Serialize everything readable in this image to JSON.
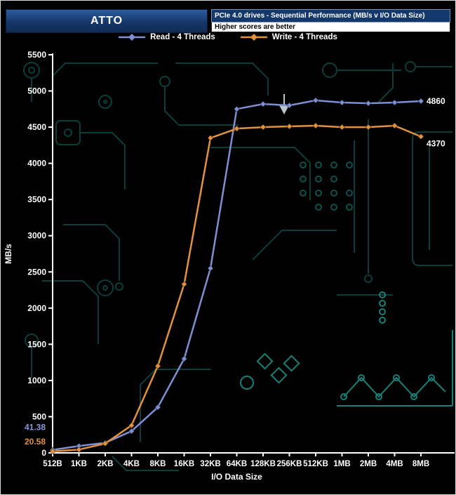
{
  "header": {
    "app_title": "ATTO",
    "chart_title": "PCIe 4.0 drives - Sequential Performance (MB/s v I/O Data Size)",
    "subtitle": "Higher scores are better"
  },
  "legend": [
    {
      "label": "Read - 4 Threads",
      "color": "#7e8fd2"
    },
    {
      "label": "Write - 4 Threads",
      "color": "#e2923e"
    }
  ],
  "chart_data": {
    "type": "line",
    "title": "PCIe 4.0 drives - Sequential Performance (MB/s v I/O Data Size)",
    "subtitle": "Higher scores are better",
    "categories": [
      "512B",
      "1KB",
      "2KB",
      "4KB",
      "8KB",
      "16KB",
      "32KB",
      "64KB",
      "128KB",
      "256KB",
      "512KB",
      "1MB",
      "2MB",
      "4MB",
      "8MB"
    ],
    "series": [
      {
        "name": "Read - 4 Threads",
        "color": "#7e8fd2",
        "values": [
          41.38,
          95,
          140,
          300,
          630,
          1300,
          2550,
          4750,
          4820,
          4800,
          4870,
          4840,
          4830,
          4840,
          4860
        ]
      },
      {
        "name": "Write - 4 Threads",
        "color": "#e2923e",
        "values": [
          20.58,
          45,
          130,
          380,
          1200,
          2330,
          4350,
          4480,
          4500,
          4510,
          4520,
          4500,
          4500,
          4520,
          4370
        ]
      }
    ],
    "annotations": [
      {
        "text": "41.38",
        "series": 0,
        "point": 0,
        "color": "#8a9ae0",
        "dx": -40,
        "dy": -28,
        "anchor": "start"
      },
      {
        "text": "20.58",
        "series": 1,
        "point": 0,
        "color": "#e2923e",
        "dx": -40,
        "dy": -10,
        "anchor": "start"
      },
      {
        "text": "4860",
        "series": 0,
        "point": 14,
        "color": "#ffffff",
        "dx": 8,
        "dy": 4,
        "anchor": "start"
      },
      {
        "text": "4370",
        "series": 1,
        "point": 14,
        "color": "#ffffff",
        "dx": 8,
        "dy": 14,
        "anchor": "start"
      }
    ],
    "xlabel": "I/O Data Size",
    "ylabel": "MB/s",
    "ylim": [
      0,
      5500
    ],
    "yticks": [
      0,
      500,
      1000,
      1500,
      2000,
      2500,
      3000,
      3500,
      4000,
      4500,
      5000,
      5500
    ],
    "grid": false,
    "legend_position": "top"
  },
  "colors": {
    "background": "#000000",
    "header_blue": "#14386b",
    "axis": "#ffffff",
    "circuit_dark": "#0c4541",
    "circuit_mid": "#0f5b55",
    "circuit_bright": "#1a8f86"
  }
}
